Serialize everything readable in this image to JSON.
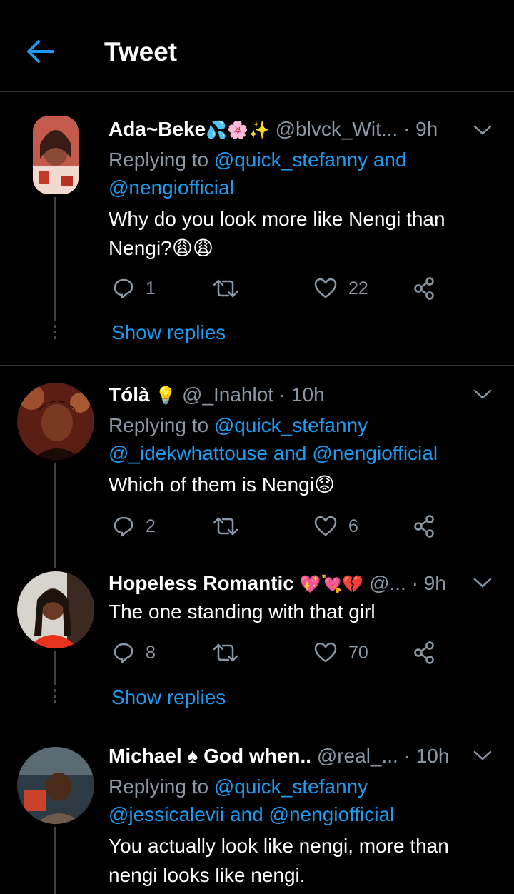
{
  "header": {
    "title": "Tweet"
  },
  "tweets": [
    {
      "name": "Ada~Beke",
      "name_emoji": "💦🌸✨",
      "handle": "@blvck_Wit...",
      "time": "· 9h",
      "replying_prefix": "Replying to",
      "mentions_line1": "@quick_stefanny and",
      "mentions_line2": "@nengiofficial",
      "text_line1": "Why do you look more like Nengi than",
      "text_line2": "Nengi?😩😩",
      "replies": "1",
      "likes": "22",
      "show_replies": "Show replies",
      "colors": {
        "avatar": [
          "#c45a4c",
          "#f1d9cf",
          "#3a1c16"
        ]
      }
    },
    {
      "name": "Tólà",
      "name_emoji": "💡",
      "handle": "@_Inahlot",
      "time": "· 10h",
      "replying_prefix": "Replying to",
      "mentions_line1": "@quick_stefanny",
      "mentions_line2": "@_idekwhattouse and @nengiofficial",
      "text_line1": "Which of them is Nengi😟",
      "replies": "2",
      "likes": "6",
      "colors": {
        "avatar": [
          "#5a1e14",
          "#b9633a",
          "#1c0a07"
        ]
      }
    },
    {
      "name": "Hopeless Romantic",
      "name_emoji": "💖💘💔",
      "handle": "@...",
      "time": "· 9h",
      "text_line1": "The one standing with that girl",
      "replies": "8",
      "likes": "70",
      "show_replies": "Show replies",
      "colors": {
        "avatar": [
          "#e8321c",
          "#3a2a22",
          "#d7d3cd"
        ]
      }
    },
    {
      "name": "Michael ♠ God when..",
      "handle": "@real_...",
      "time": "· 10h",
      "replying_prefix": "Replying to",
      "mentions_line1": "@quick_stefanny",
      "mentions_line2": "@jessicalevii and @nengiofficial",
      "text_line1": "You actually look like nengi, more than",
      "text_line2": "nengi looks like nengi.",
      "colors": {
        "avatar": [
          "#2d3a44",
          "#c9422c",
          "#6e5a4a"
        ]
      }
    }
  ],
  "icons": [
    "back-arrow-icon",
    "chevron-down-icon",
    "reply-icon",
    "retweet-icon",
    "like-icon",
    "share-icon"
  ],
  "colors": {
    "accent": "#1d9bf0",
    "muted": "#8b98a5",
    "background": "#000000",
    "divider": "#2f3336"
  }
}
